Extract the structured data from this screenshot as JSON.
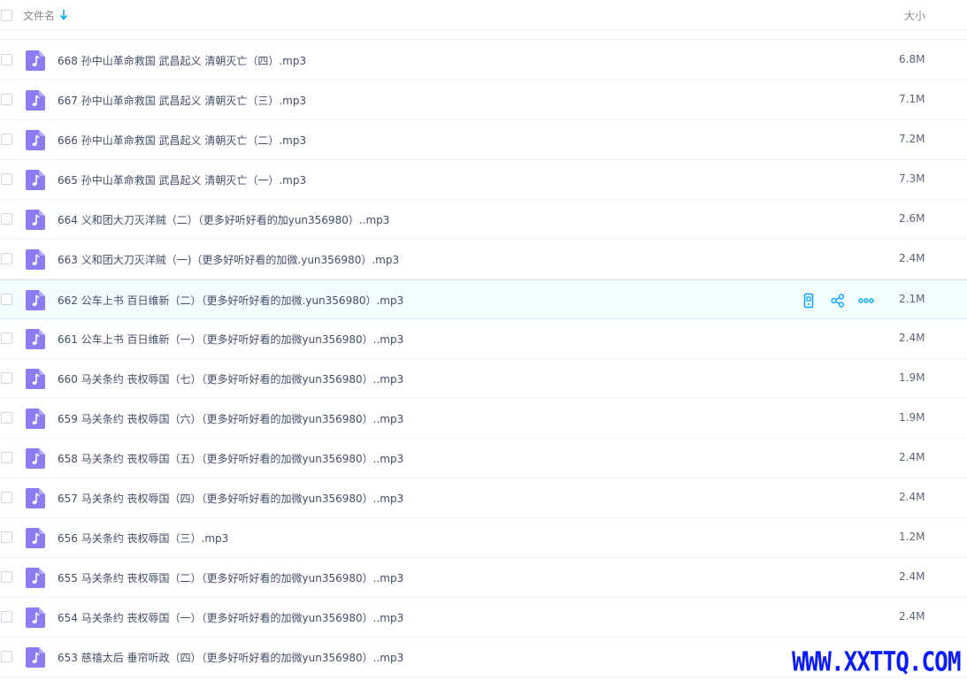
{
  "header": {
    "name_label": "文件名",
    "size_label": "大小",
    "sort_icon": "arrow-down-icon",
    "accent": "#06a7ff"
  },
  "file_icon": {
    "name": "music-note-icon",
    "color": "#8b7cf2"
  },
  "hover_actions": [
    {
      "name": "phone-icon"
    },
    {
      "name": "share-icon"
    },
    {
      "name": "more-icon"
    }
  ],
  "files": [
    {
      "name": "668 孙中山革命救国 武昌起义 清朝灭亡（四）.mp3",
      "size": "6.8M"
    },
    {
      "name": "667 孙中山革命救国 武昌起义 清朝灭亡（三）.mp3",
      "size": "7.1M"
    },
    {
      "name": "666 孙中山革命救国 武昌起义 清朝灭亡（二）.mp3",
      "size": "7.2M"
    },
    {
      "name": "665 孙中山革命救国 武昌起义 清朝灭亡（一）.mp3",
      "size": "7.3M"
    },
    {
      "name": "664 义和团大刀灭洋贼（二）（更多好听好看的加yun356980）..mp3",
      "size": "2.6M"
    },
    {
      "name": "663 义和团大刀灭洋贼（一)（更多好听好看的加微.yun356980）.mp3",
      "size": "2.4M"
    },
    {
      "name": "662 公车上书 百日维新（二）（更多好听好看的加微.yun356980）.mp3",
      "size": "2.1M",
      "hovered": true
    },
    {
      "name": "661 公车上书 百日维新（一）（更多好听好看的加微yun356980）..mp3",
      "size": "2.4M"
    },
    {
      "name": "660 马关条约 丧权辱国（七）（更多好听好看的加微yun356980）..mp3",
      "size": "1.9M"
    },
    {
      "name": "659 马关条约 丧权辱国（六）（更多好听好看的加微yun356980）..mp3",
      "size": "1.9M"
    },
    {
      "name": "658 马关条约 丧权辱国（五）（更多好听好看的加微yun356980）..mp3",
      "size": "2.4M"
    },
    {
      "name": "657 马关条约 丧权辱国（四）（更多好听好看的加微yun356980）..mp3",
      "size": "2.4M"
    },
    {
      "name": "656 马关条约 丧权辱国（三）.mp3",
      "size": "1.2M"
    },
    {
      "name": "655 马关条约 丧权辱国（二）（更多好听好看的加微yun356980）..mp3",
      "size": "2.4M"
    },
    {
      "name": "654 马关条约 丧权辱国（一）（更多好听好看的加微yun356980）..mp3",
      "size": "2.4M"
    },
    {
      "name": "653 慈禧太后 垂帘听政（四）（更多好听好看的加微yun356980）..mp3",
      "size": ""
    }
  ],
  "watermark": {
    "text": "WWW.XXTTQ.COM",
    "color": "#0a1cff"
  }
}
